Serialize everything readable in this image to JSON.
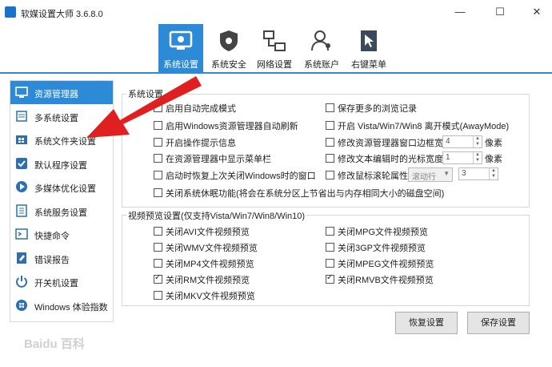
{
  "window": {
    "title": "软媒设置大师 3.6.8.0",
    "min": "—",
    "max": "☐",
    "close": "✕"
  },
  "toolbar": [
    {
      "label": "系统设置",
      "icon": "monitor-gear-icon"
    },
    {
      "label": "系统安全",
      "icon": "shield-gear-icon"
    },
    {
      "label": "网络设置",
      "icon": "network-icon"
    },
    {
      "label": "系统账户",
      "icon": "users-icon"
    },
    {
      "label": "右键菜单",
      "icon": "context-menu-icon"
    }
  ],
  "sidebar": [
    {
      "label": "资源管理器",
      "icon": "explorer-icon"
    },
    {
      "label": "多系统设置",
      "icon": "multi-system-icon"
    },
    {
      "label": "系统文件夹设置",
      "icon": "folder-windows-icon"
    },
    {
      "label": "默认程序设置",
      "icon": "check-shield-icon"
    },
    {
      "label": "多媒体优化设置",
      "icon": "media-icon"
    },
    {
      "label": "系统服务设置",
      "icon": "services-icon"
    },
    {
      "label": "快捷命令",
      "icon": "command-icon"
    },
    {
      "label": "错误报告",
      "icon": "report-icon"
    },
    {
      "label": "开关机设置",
      "icon": "power-icon"
    },
    {
      "label": "Windows 体验指数",
      "icon": "windows-logo-icon"
    }
  ],
  "system_group": {
    "title": "系统设置",
    "left": [
      {
        "label": "启用自动完成模式",
        "checked": false
      },
      {
        "label": "启用Windows资源管理器自动刷新",
        "checked": false
      },
      {
        "label": "开启操作提示信息",
        "checked": false
      },
      {
        "label": "在资源管理器中显示菜单栏",
        "checked": false
      },
      {
        "label": "启动时恢复上次关闭Windows时的窗口",
        "checked": false
      },
      {
        "label": "关闭系统休眠功能(将会在系统分区上节省出与内存相同大小的磁盘空间)",
        "checked": false
      }
    ],
    "right": [
      {
        "label": "保存更多的浏览记录",
        "checked": false
      },
      {
        "label": "开启 Vista/Win7/Win8 离开模式(AwayMode)",
        "checked": false
      },
      {
        "label": "修改资源管理器窗口边框宽度",
        "checked": false
      },
      {
        "label": "修改文本编辑时的光标宽度为",
        "checked": false
      },
      {
        "label": "修改鼠标滚轮属性",
        "checked": false
      }
    ],
    "border_width": "4",
    "cursor_width": "1",
    "unit": "像素",
    "wheel_mode": "滚动行",
    "wheel_value": "3"
  },
  "video_group": {
    "title": "视频预览设置(仅支持Vista/Win7/Win8/Win10)",
    "left": [
      {
        "label": "关闭AVI文件视频预览",
        "checked": false
      },
      {
        "label": "关闭WMV文件视频预览",
        "checked": false
      },
      {
        "label": "关闭MP4文件视频预览",
        "checked": false
      },
      {
        "label": "关闭RM文件视频预览",
        "checked": true
      },
      {
        "label": "关闭MKV文件视频预览",
        "checked": false
      }
    ],
    "right": [
      {
        "label": "关闭MPG文件视频预览",
        "checked": false
      },
      {
        "label": "关闭3GP文件视频预览",
        "checked": false
      },
      {
        "label": "关闭MPEG文件视频预览",
        "checked": false
      },
      {
        "label": "关闭RMVB文件视频预览",
        "checked": true
      }
    ]
  },
  "buttons": {
    "restore": "恢复设置",
    "save": "保存设置"
  },
  "watermark": "Baidu 百科",
  "colors": {
    "accent": "#2d8ad6",
    "arrow": "#e02020"
  }
}
